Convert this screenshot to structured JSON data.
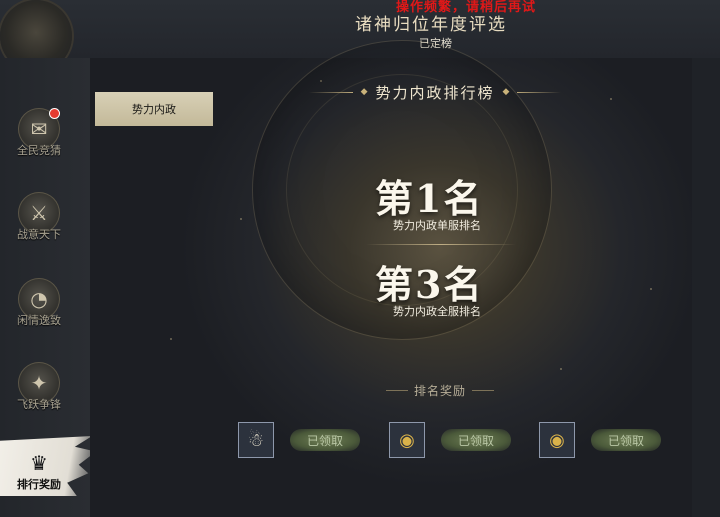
{
  "header": {
    "warning": "操作频繁，请稍后再试",
    "title": "诸神归位年度评选",
    "subtitle": "已定榜"
  },
  "sidebar": {
    "items": [
      {
        "label": "全民竞猜",
        "icon": "ticket-icon",
        "badge": true
      },
      {
        "label": "战意天下",
        "icon": "sword-emblem-icon"
      },
      {
        "label": "闲情逸致",
        "icon": "fan-icon"
      },
      {
        "label": "飞跃争锋",
        "icon": "compass-icon"
      },
      {
        "label": "排行奖励",
        "icon": "ranking-icon",
        "active": true
      }
    ]
  },
  "tab": {
    "label": "势力内政"
  },
  "ranking": {
    "title": "势力内政排行榜",
    "server_rank": "第1名",
    "server_rank_label": "势力内政单服排名",
    "global_rank": "第3名",
    "global_rank_label": "势力内政全服排名"
  },
  "rewards": {
    "title": "排名奖励",
    "items": [
      {
        "icon": "snowman-avatar-icon",
        "status": "已领取"
      },
      {
        "icon": "gold-bowl-icon",
        "status": "已领取"
      },
      {
        "icon": "gold-bowl-icon",
        "status": "已领取"
      }
    ]
  },
  "colors": {
    "accent_gold": "#c9b27a",
    "warning_red": "#e01818",
    "claimed_green": "#6f7e55"
  }
}
